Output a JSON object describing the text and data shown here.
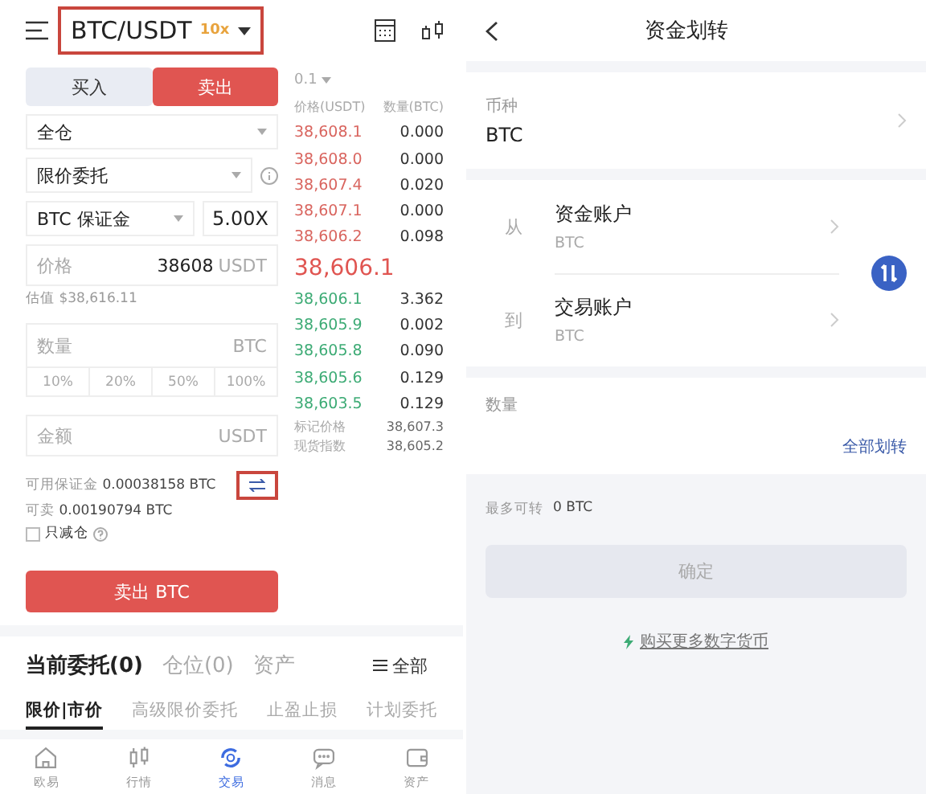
{
  "trade": {
    "pair": "BTC/USDT",
    "leverage": "10x",
    "side_tabs": [
      {
        "label": "买入",
        "selected": false
      },
      {
        "label": "卖出",
        "selected": true
      }
    ],
    "margin_mode": "全仓",
    "order_type": "限价委托",
    "margin_currency": "BTC 保证金",
    "leverage_value": "5.00X",
    "price_field": {
      "placeholder": "价格",
      "value": "38608",
      "unit": "USDT"
    },
    "estimate": "估值 $38,616.11",
    "quantity_field": {
      "placeholder": "数量",
      "unit": "BTC"
    },
    "percents": [
      "10%",
      "20%",
      "50%",
      "100%"
    ],
    "amount_field": {
      "placeholder": "金额",
      "unit": "USDT"
    },
    "available": {
      "label": "可用保证金",
      "value": "0.00038158 BTC"
    },
    "sellable": {
      "label": "可卖",
      "value": "0.00190794 BTC"
    },
    "reduce_only": {
      "label": "只减仓",
      "checked": false
    },
    "submit": "卖出 BTC",
    "order_book": {
      "precision": "0.1",
      "columns": [
        "价格(USDT)",
        "数量(BTC)"
      ],
      "asks": [
        {
          "price": "38,608.1",
          "qty": "0.000"
        },
        {
          "price": "38,608.0",
          "qty": "0.000"
        },
        {
          "price": "38,607.4",
          "qty": "0.020"
        },
        {
          "price": "38,607.1",
          "qty": "0.000"
        },
        {
          "price": "38,606.2",
          "qty": "0.098"
        }
      ],
      "last_price": "38,606.1",
      "bids": [
        {
          "price": "38,606.1",
          "qty": "3.362"
        },
        {
          "price": "38,605.9",
          "qty": "0.002"
        },
        {
          "price": "38,605.8",
          "qty": "0.090"
        },
        {
          "price": "38,605.6",
          "qty": "0.129"
        },
        {
          "price": "38,603.5",
          "qty": "0.129"
        }
      ],
      "marks": [
        {
          "label": "标记价格",
          "value": "38,607.3"
        },
        {
          "label": "现货指数",
          "value": "38,605.2"
        }
      ]
    },
    "order_tabs": [
      {
        "label": "当前委托(0)",
        "selected": true
      },
      {
        "label": "仓位(0)",
        "selected": false
      },
      {
        "label": "资产",
        "selected": false
      }
    ],
    "filter": "全部",
    "order_subtabs": [
      {
        "label": "限价|市价",
        "selected": true
      },
      {
        "label": "高级限价委托",
        "selected": false
      },
      {
        "label": "止盈止损",
        "selected": false
      },
      {
        "label": "计划委托",
        "selected": false
      }
    ],
    "nav": [
      {
        "label": "欧易",
        "selected": false
      },
      {
        "label": "行情",
        "selected": false
      },
      {
        "label": "交易",
        "selected": true
      },
      {
        "label": "消息",
        "selected": false
      },
      {
        "label": "资产",
        "selected": false
      }
    ]
  },
  "transfer": {
    "title": "资金划转",
    "coin": {
      "label": "币种",
      "value": "BTC"
    },
    "from": {
      "label": "从",
      "account": "资金账户",
      "coin": "BTC"
    },
    "to": {
      "label": "到",
      "account": "交易账户",
      "coin": "BTC"
    },
    "quantity": {
      "label": "数量",
      "action": "全部划转"
    },
    "max": {
      "label": "最多可转",
      "value": "0 BTC"
    },
    "confirm": {
      "label": "确定",
      "disabled": true
    },
    "link": "购买更多数字货币"
  }
}
